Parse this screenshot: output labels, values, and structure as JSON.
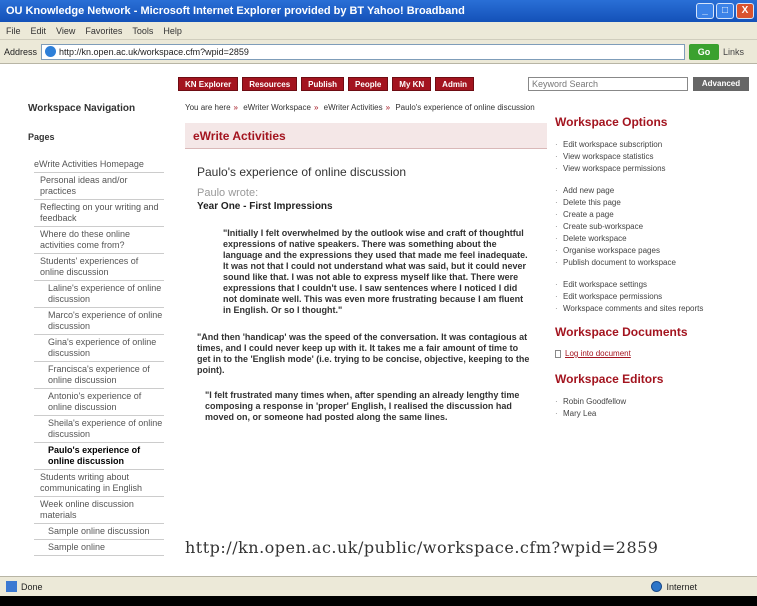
{
  "window": {
    "title": "OU Knowledge Network - Microsoft Internet Explorer provided by BT Yahoo! Broadband",
    "minimize": "_",
    "maximize": "□",
    "close": "X"
  },
  "menu": [
    "File",
    "Edit",
    "View",
    "Favorites",
    "Tools",
    "Help"
  ],
  "address": {
    "label": "Address",
    "url": "http://kn.open.ac.uk/workspace.cfm?wpid=2859",
    "go_label": "Go",
    "links_label": "Links"
  },
  "nav_tabs": [
    "KN Explorer",
    "Resources",
    "Publish",
    "People",
    "My KN",
    "Admin"
  ],
  "search": {
    "placeholder": "Keyword Search",
    "button_label": "Advanced"
  },
  "breadcrumb": [
    "You are here",
    "eWriter Workspace",
    "eWriter Activities",
    "Paulo's experience of online discussion"
  ],
  "left_nav": {
    "heading": "Workspace Navigation",
    "pages_label": "Pages",
    "items": [
      {
        "label": "eWrite Activities Homepage",
        "level": 0
      },
      {
        "label": "Personal ideas and/or practices",
        "level": 1
      },
      {
        "label": "Reflecting on your writing and feedback",
        "level": 1
      },
      {
        "label": "Where do these online activities come from?",
        "level": 1
      },
      {
        "label": "Students' experiences of online discussion",
        "level": 1
      },
      {
        "label": "Laline's experience of online discussion",
        "level": 2
      },
      {
        "label": "Marco's experience of online discussion",
        "level": 2
      },
      {
        "label": "Gina's experience of online discussion",
        "level": 2
      },
      {
        "label": "Francisca's experience of online discussion",
        "level": 2
      },
      {
        "label": "Antonio's experience of online discussion",
        "level": 2
      },
      {
        "label": "Sheila's experience of online discussion",
        "level": 2
      },
      {
        "label": "Paulo's experience of online discussion",
        "level": 2,
        "active": true
      },
      {
        "label": "Students writing about communicating in English",
        "level": 1
      },
      {
        "label": "Week online discussion materials",
        "level": 1
      },
      {
        "label": "Sample online discussion",
        "level": 2
      },
      {
        "label": "Sample online",
        "level": 2
      }
    ]
  },
  "content": {
    "section_title": "eWrite Activities",
    "post_heading": "Paulo's experience of online discussion",
    "author": "Paulo wrote:",
    "subheading": "Year One - First Impressions",
    "quote1": "\"Initially I felt overwhelmed by the outlook wise and craft of thoughtful expressions of native speakers. There was something about the language and the expressions they used that made me feel inadequate. It was not that I could not understand what was said, but it could never sound like that. I was not able to express myself like that. There were expressions that I couldn't use. I saw sentences where I noticed I did not dominate well. This was even more frustrating because I am fluent in English. Or so I thought.\"",
    "para": "\"And then 'handicap' was the speed of the conversation. It was contagious at times, and I could never keep up with it. It takes me a fair amount of time to get in to the 'English mode' (i.e. trying to be concise, objective, keeping to the point).",
    "quote2": "\"I felt frustrated many times when, after spending an already lengthy time composing a response in 'proper' English, I realised the discussion had moved on, or someone had posted along the same lines."
  },
  "sidebar": {
    "options_heading": "Workspace Options",
    "options_group1": [
      "Edit workspace subscription",
      "View workspace statistics",
      "View workspace permissions"
    ],
    "options_group2": [
      "Add new page",
      "Delete this page",
      "Create a page",
      "Create sub-workspace",
      "Delete workspace",
      "Organise workspace pages",
      "Publish document to workspace"
    ],
    "options_group3": [
      "Edit workspace settings",
      "Edit workspace permissions",
      "Workspace comments and sites reports"
    ],
    "documents_heading": "Workspace Documents",
    "documents": [
      "Log into document"
    ],
    "editors_heading": "Workspace Editors",
    "editors": [
      "Robin Goodfellow",
      "Mary Lea"
    ]
  },
  "overlay_url": "http://kn.open.ac.uk/public/workspace.cfm?wpid=2859",
  "status": {
    "left": "Done",
    "zone": "Internet"
  }
}
